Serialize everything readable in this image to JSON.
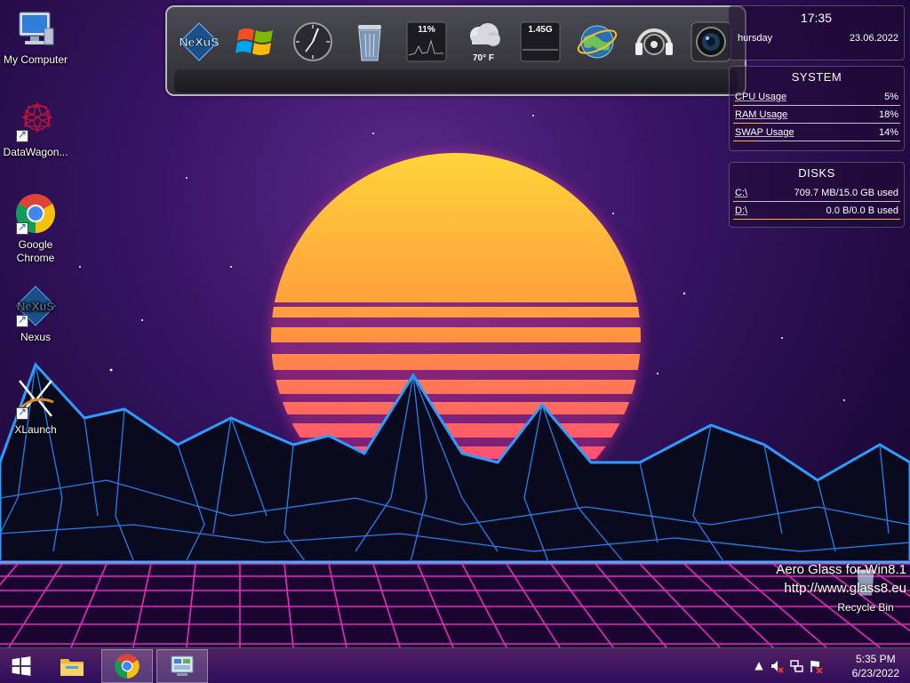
{
  "desktop": {
    "icons": [
      {
        "label": "My Computer",
        "icon": "computer-icon"
      },
      {
        "label": "DataWagon...",
        "icon": "datawagon-icon"
      },
      {
        "label": "Google Chrome",
        "icon": "chrome-icon"
      },
      {
        "label": "Nexus",
        "icon": "nexus-icon"
      },
      {
        "label": "XLaunch",
        "icon": "xlaunch-icon"
      }
    ],
    "recycle_bin_label": "Recycle Bin"
  },
  "dock": {
    "items": [
      {
        "name": "nexus",
        "icon": "nexus-logo-icon"
      },
      {
        "name": "windows",
        "icon": "windows-logo-icon"
      },
      {
        "name": "clock",
        "icon": "clock-icon"
      },
      {
        "name": "recycle-bin",
        "icon": "trash-icon"
      },
      {
        "name": "cpu-meter",
        "icon": "cpu-meter-icon",
        "text": "11%"
      },
      {
        "name": "weather",
        "icon": "weather-icon",
        "text": "70° F"
      },
      {
        "name": "memory-meter",
        "icon": "memory-meter-icon",
        "text": "1.45G"
      },
      {
        "name": "network",
        "icon": "network-globe-icon"
      },
      {
        "name": "media-player",
        "icon": "speaker-icon"
      },
      {
        "name": "camera",
        "icon": "camera-icon"
      }
    ]
  },
  "clock_gadget": {
    "time": "17:35",
    "day": "hursday",
    "date": "23.06.2022"
  },
  "system_gadget": {
    "title": "SYSTEM",
    "rows": [
      {
        "label": "CPU Usage",
        "value": "5%",
        "level": 5
      },
      {
        "label": "RAM Usage",
        "value": "18%",
        "level": 18
      },
      {
        "label": "SWAP Usage",
        "value": "14%",
        "level": 14
      }
    ]
  },
  "disks_gadget": {
    "title": "DISKS",
    "rows": [
      {
        "label": "C:\\",
        "value": "709.7 MB/15.0 GB used",
        "level": 4.7
      },
      {
        "label": "D:\\",
        "value": "0.0 B/0.0 B used",
        "level": 100
      }
    ]
  },
  "watermark": {
    "line1": "Aero Glass for Win8.1",
    "line2": "http://www.glass8.eu"
  },
  "taskbar": {
    "clock_time": "5:35 PM",
    "clock_date": "6/23/2022"
  },
  "colors": {
    "accent_sun_top": "#ffd23f",
    "accent_sun_bottom": "#ff2e88",
    "grid_blue": "#2a8cff",
    "grid_pink": "#ff2fd0"
  }
}
